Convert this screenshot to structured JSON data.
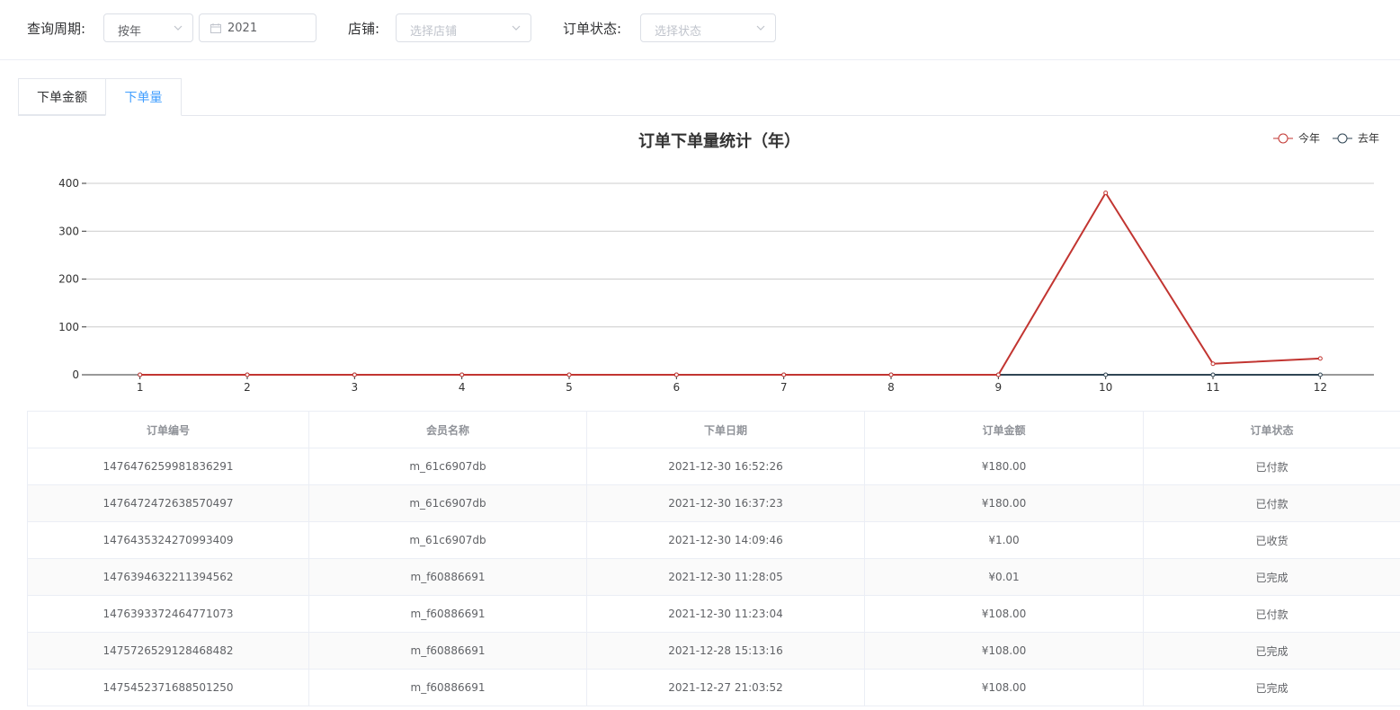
{
  "filters": {
    "period_label": "查询周期:",
    "period_value": "按年",
    "year_value": "2021",
    "shop_label": "店铺:",
    "shop_placeholder": "选择店铺",
    "status_label": "订单状态:",
    "status_placeholder": "选择状态"
  },
  "tabs": [
    {
      "label": "下单金额",
      "active": false
    },
    {
      "label": "下单量",
      "active": true
    }
  ],
  "colors": {
    "this_year": "#c23531",
    "last_year": "#2f4554",
    "accent": "#409eff"
  },
  "chart_data": {
    "type": "line",
    "title": "订单下单量统计（年）",
    "categories": [
      "1",
      "2",
      "3",
      "4",
      "5",
      "6",
      "7",
      "8",
      "9",
      "10",
      "11",
      "12"
    ],
    "series": [
      {
        "name": "今年",
        "values": [
          0,
          0,
          0,
          0,
          0,
          0,
          0,
          0,
          0,
          380,
          23,
          34
        ]
      },
      {
        "name": "去年",
        "values": [
          0,
          0,
          0,
          0,
          0,
          0,
          0,
          0,
          0,
          0,
          0,
          0
        ]
      }
    ],
    "yticks": [
      "0",
      "100",
      "200",
      "300",
      "400"
    ],
    "ylim": [
      0,
      400
    ],
    "legend_position": "top-right",
    "grid": true
  },
  "table": {
    "columns": [
      "订单编号",
      "会员名称",
      "下单日期",
      "订单金额",
      "订单状态"
    ],
    "rows": [
      [
        "1476476259981836291",
        "m_61c6907db",
        "2021-12-30 16:52:26",
        "¥180.00",
        "已付款"
      ],
      [
        "1476472472638570497",
        "m_61c6907db",
        "2021-12-30 16:37:23",
        "¥180.00",
        "已付款"
      ],
      [
        "1476435324270993409",
        "m_61c6907db",
        "2021-12-30 14:09:46",
        "¥1.00",
        "已收货"
      ],
      [
        "1476394632211394562",
        "m_f60886691",
        "2021-12-30 11:28:05",
        "¥0.01",
        "已完成"
      ],
      [
        "1476393372464771073",
        "m_f60886691",
        "2021-12-30 11:23:04",
        "¥108.00",
        "已付款"
      ],
      [
        "1475726529128468482",
        "m_f60886691",
        "2021-12-28 15:13:16",
        "¥108.00",
        "已完成"
      ],
      [
        "1475452371688501250",
        "m_f60886691",
        "2021-12-27 21:03:52",
        "¥108.00",
        "已完成"
      ]
    ]
  }
}
